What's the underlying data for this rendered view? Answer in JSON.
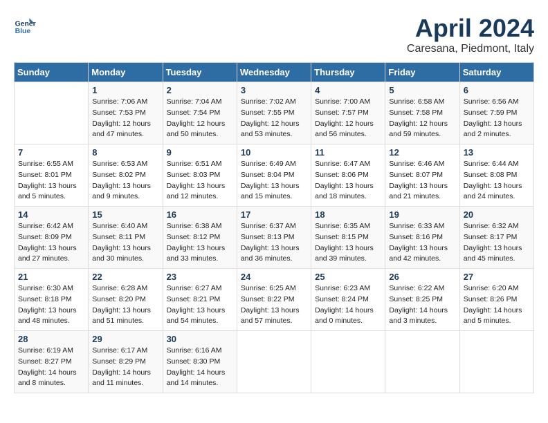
{
  "header": {
    "logo_line1": "General",
    "logo_line2": "Blue",
    "month": "April 2024",
    "location": "Caresana, Piedmont, Italy"
  },
  "days_of_week": [
    "Sunday",
    "Monday",
    "Tuesday",
    "Wednesday",
    "Thursday",
    "Friday",
    "Saturday"
  ],
  "weeks": [
    [
      {
        "day": "",
        "info": ""
      },
      {
        "day": "1",
        "info": "Sunrise: 7:06 AM\nSunset: 7:53 PM\nDaylight: 12 hours\nand 47 minutes."
      },
      {
        "day": "2",
        "info": "Sunrise: 7:04 AM\nSunset: 7:54 PM\nDaylight: 12 hours\nand 50 minutes."
      },
      {
        "day": "3",
        "info": "Sunrise: 7:02 AM\nSunset: 7:55 PM\nDaylight: 12 hours\nand 53 minutes."
      },
      {
        "day": "4",
        "info": "Sunrise: 7:00 AM\nSunset: 7:57 PM\nDaylight: 12 hours\nand 56 minutes."
      },
      {
        "day": "5",
        "info": "Sunrise: 6:58 AM\nSunset: 7:58 PM\nDaylight: 12 hours\nand 59 minutes."
      },
      {
        "day": "6",
        "info": "Sunrise: 6:56 AM\nSunset: 7:59 PM\nDaylight: 13 hours\nand 2 minutes."
      }
    ],
    [
      {
        "day": "7",
        "info": "Sunrise: 6:55 AM\nSunset: 8:01 PM\nDaylight: 13 hours\nand 5 minutes."
      },
      {
        "day": "8",
        "info": "Sunrise: 6:53 AM\nSunset: 8:02 PM\nDaylight: 13 hours\nand 9 minutes."
      },
      {
        "day": "9",
        "info": "Sunrise: 6:51 AM\nSunset: 8:03 PM\nDaylight: 13 hours\nand 12 minutes."
      },
      {
        "day": "10",
        "info": "Sunrise: 6:49 AM\nSunset: 8:04 PM\nDaylight: 13 hours\nand 15 minutes."
      },
      {
        "day": "11",
        "info": "Sunrise: 6:47 AM\nSunset: 8:06 PM\nDaylight: 13 hours\nand 18 minutes."
      },
      {
        "day": "12",
        "info": "Sunrise: 6:46 AM\nSunset: 8:07 PM\nDaylight: 13 hours\nand 21 minutes."
      },
      {
        "day": "13",
        "info": "Sunrise: 6:44 AM\nSunset: 8:08 PM\nDaylight: 13 hours\nand 24 minutes."
      }
    ],
    [
      {
        "day": "14",
        "info": "Sunrise: 6:42 AM\nSunset: 8:09 PM\nDaylight: 13 hours\nand 27 minutes."
      },
      {
        "day": "15",
        "info": "Sunrise: 6:40 AM\nSunset: 8:11 PM\nDaylight: 13 hours\nand 30 minutes."
      },
      {
        "day": "16",
        "info": "Sunrise: 6:38 AM\nSunset: 8:12 PM\nDaylight: 13 hours\nand 33 minutes."
      },
      {
        "day": "17",
        "info": "Sunrise: 6:37 AM\nSunset: 8:13 PM\nDaylight: 13 hours\nand 36 minutes."
      },
      {
        "day": "18",
        "info": "Sunrise: 6:35 AM\nSunset: 8:15 PM\nDaylight: 13 hours\nand 39 minutes."
      },
      {
        "day": "19",
        "info": "Sunrise: 6:33 AM\nSunset: 8:16 PM\nDaylight: 13 hours\nand 42 minutes."
      },
      {
        "day": "20",
        "info": "Sunrise: 6:32 AM\nSunset: 8:17 PM\nDaylight: 13 hours\nand 45 minutes."
      }
    ],
    [
      {
        "day": "21",
        "info": "Sunrise: 6:30 AM\nSunset: 8:18 PM\nDaylight: 13 hours\nand 48 minutes."
      },
      {
        "day": "22",
        "info": "Sunrise: 6:28 AM\nSunset: 8:20 PM\nDaylight: 13 hours\nand 51 minutes."
      },
      {
        "day": "23",
        "info": "Sunrise: 6:27 AM\nSunset: 8:21 PM\nDaylight: 13 hours\nand 54 minutes."
      },
      {
        "day": "24",
        "info": "Sunrise: 6:25 AM\nSunset: 8:22 PM\nDaylight: 13 hours\nand 57 minutes."
      },
      {
        "day": "25",
        "info": "Sunrise: 6:23 AM\nSunset: 8:24 PM\nDaylight: 14 hours\nand 0 minutes."
      },
      {
        "day": "26",
        "info": "Sunrise: 6:22 AM\nSunset: 8:25 PM\nDaylight: 14 hours\nand 3 minutes."
      },
      {
        "day": "27",
        "info": "Sunrise: 6:20 AM\nSunset: 8:26 PM\nDaylight: 14 hours\nand 5 minutes."
      }
    ],
    [
      {
        "day": "28",
        "info": "Sunrise: 6:19 AM\nSunset: 8:27 PM\nDaylight: 14 hours\nand 8 minutes."
      },
      {
        "day": "29",
        "info": "Sunrise: 6:17 AM\nSunset: 8:29 PM\nDaylight: 14 hours\nand 11 minutes."
      },
      {
        "day": "30",
        "info": "Sunrise: 6:16 AM\nSunset: 8:30 PM\nDaylight: 14 hours\nand 14 minutes."
      },
      {
        "day": "",
        "info": ""
      },
      {
        "day": "",
        "info": ""
      },
      {
        "day": "",
        "info": ""
      },
      {
        "day": "",
        "info": ""
      }
    ]
  ]
}
